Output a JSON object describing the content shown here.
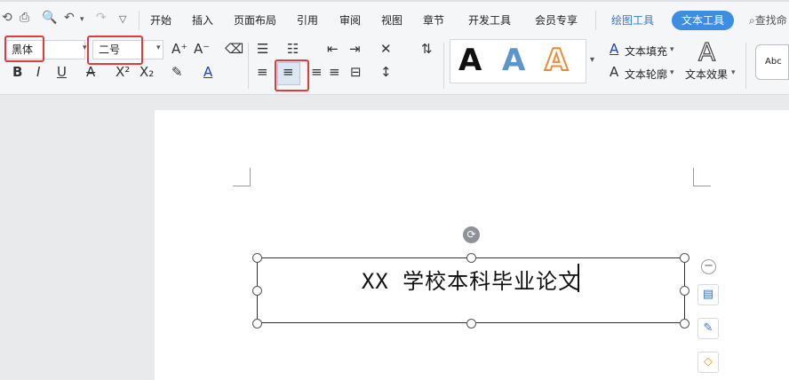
{
  "menu": {
    "items": [
      "开始",
      "插入",
      "页面布局",
      "引用",
      "审阅",
      "视图",
      "章节",
      "开发工具",
      "会员专享"
    ],
    "drawing_tools": "绘图工具",
    "text_tools": "文本工具",
    "search": "查找命"
  },
  "font": {
    "name": "黑体",
    "size": "二号"
  },
  "ribbon": {
    "text_fill": "文本填充",
    "text_outline": "文本轮廓",
    "text_effect": "文本效果",
    "style_sample": "Abc",
    "big_a": "A"
  },
  "document": {
    "textbox_text": "XX 学校本科毕业论文"
  }
}
